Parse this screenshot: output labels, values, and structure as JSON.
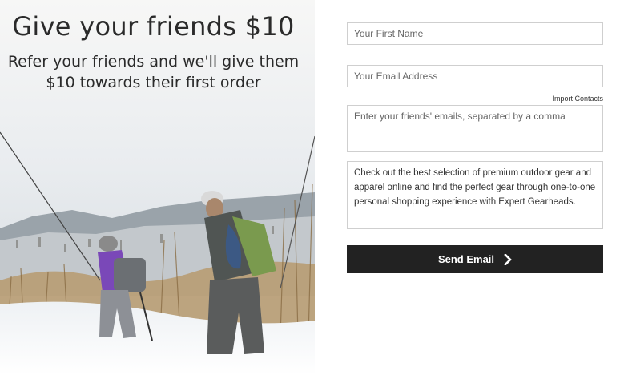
{
  "hero": {
    "title": "Give your friends $10",
    "subtitle_line1": "Refer your friends and we'll give them",
    "subtitle_line2": "$10 towards their first order"
  },
  "form": {
    "first_name_placeholder": "Your First Name",
    "email_placeholder": "Your Email Address",
    "import_contacts_label": "Import Contacts",
    "friends_emails_placeholder": "Enter your friends' emails, separated by a comma",
    "message_text": "Check out the best selection of premium outdoor gear and apparel online and find the perfect gear through one-to-one personal shopping experience with Expert Gearheads.",
    "send_button_label": "Send Email",
    "send_icon": "chevron-right-icon"
  },
  "colors": {
    "button_bg": "#222222",
    "button_text": "#ffffff",
    "field_border": "#cfcfcf"
  }
}
